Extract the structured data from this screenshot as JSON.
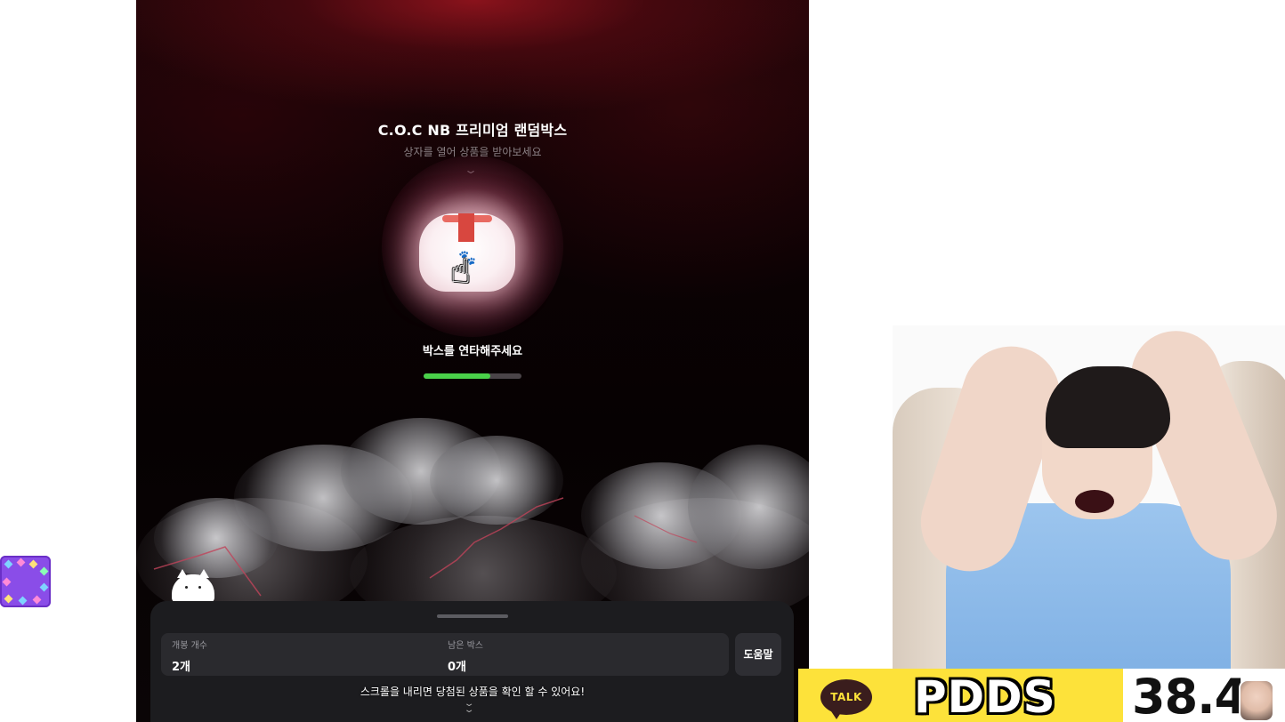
{
  "game": {
    "title": "C.O.C NB 프리미엄 랜덤박스",
    "subtitle": "상자를 열어 상품을 받아보세요",
    "tap_prompt": "박스를 연타해주세요",
    "progress": 0.68,
    "stats": {
      "opened_label": "개봉 개수",
      "opened_value": "2개",
      "remaining_label": "남은 박스",
      "remaining_value": "0개"
    },
    "help_label": "도움말",
    "scroll_hint": "스크롤을 내리면 당첨된 상품을 확인 할 수 있어요!"
  },
  "overlay": {
    "talk_label": "TALK",
    "brand_text": "PDDS",
    "number_text": "38.4"
  },
  "colors": {
    "progress_fill": "#4ad14a",
    "talk_yellow": "#fde23a",
    "widget_purple": "#8a4de8"
  },
  "icons": {
    "cursor": "hand-pointer-icon",
    "chevron": "chevron-down-icon",
    "double_chevron": "double-chevron-down-icon"
  }
}
